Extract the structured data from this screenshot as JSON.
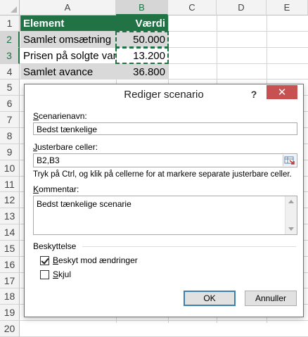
{
  "sheet": {
    "columns": [
      "A",
      "B",
      "C",
      "D",
      "E"
    ],
    "rows": [
      "1",
      "2",
      "3",
      "4",
      "5",
      "6",
      "7",
      "8",
      "9",
      "10",
      "11",
      "12",
      "13",
      "14",
      "15",
      "16",
      "17",
      "18",
      "19",
      "20"
    ],
    "header": {
      "label": "Element",
      "value": "Værdi"
    },
    "data": [
      {
        "label": "Samlet omsætning",
        "value": "50.000"
      },
      {
        "label": "Prisen på solgte varer",
        "value": "13.200"
      },
      {
        "label": "Samlet avance",
        "value": "36.800"
      }
    ],
    "colors": {
      "header_bg": "#217346",
      "selected_bg": "#d9d9d9"
    }
  },
  "dialog": {
    "title": "Rediger scenario",
    "help": "?",
    "close": "✕",
    "scenario_name_label_underlined": "S",
    "scenario_name_label_rest": "cenarienavn:",
    "scenario_name_value": "Bedst tænkelige",
    "changing_cells_label_underlined": "J",
    "changing_cells_label_rest": "usterbare celler:",
    "changing_cells_value": "B2,B3",
    "hint": "Tryk på Ctrl, og klik på cellerne for at markere separate justerbare celler.",
    "comment_label_underlined": "K",
    "comment_label_rest": "ommentar:",
    "comment_value": "Bedst tænkelige scenarie",
    "protection_label": "Beskyttelse",
    "prevent_changes_underlined": "B",
    "prevent_changes_rest": "eskyt mod ændringer",
    "prevent_changes_checked": true,
    "hide_underlined": "S",
    "hide_rest": "kjul",
    "hide_checked": false,
    "ok": "OK",
    "cancel": "Annuller"
  }
}
